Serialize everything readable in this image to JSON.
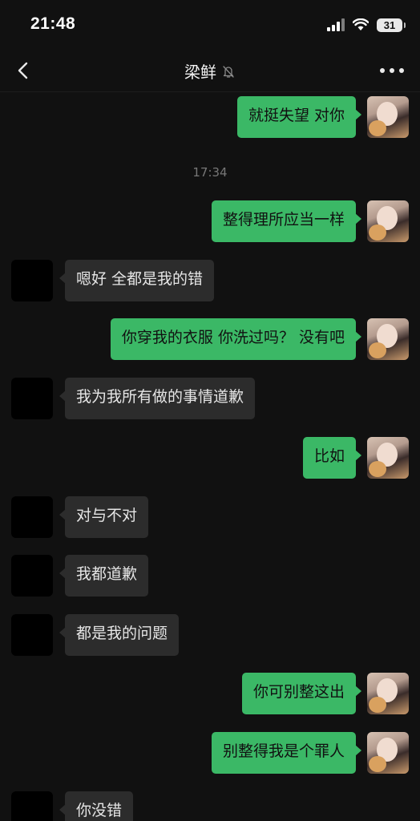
{
  "status_bar": {
    "time": "21:48",
    "battery": "31"
  },
  "nav": {
    "title": "梁鲜"
  },
  "timestamp": "17:34",
  "messages": [
    {
      "side": "out",
      "text": "就挺失望 对你"
    },
    {
      "side": "out",
      "text": "整得理所应当一样"
    },
    {
      "side": "in",
      "text": "嗯好 全都是我的错"
    },
    {
      "side": "out",
      "text": "你穿我的衣服 你洗过吗？ 没有吧"
    },
    {
      "side": "in",
      "text": "我为我所有做的事情道歉"
    },
    {
      "side": "out",
      "text": "比如"
    },
    {
      "side": "in",
      "text": "对与不对"
    },
    {
      "side": "in",
      "text": "我都道歉"
    },
    {
      "side": "in",
      "text": "都是我的问题"
    },
    {
      "side": "out",
      "text": "你可别整这出"
    },
    {
      "side": "out",
      "text": "别整得我是个罪人"
    },
    {
      "side": "in",
      "text": "你没错"
    }
  ],
  "colors": {
    "outgoing_bubble": "#3bb866",
    "incoming_bubble": "#2c2c2c",
    "background": "#111111"
  },
  "icons": [
    "back-icon",
    "mute-icon",
    "more-icon",
    "signal-icon",
    "wifi-icon",
    "battery-icon"
  ]
}
